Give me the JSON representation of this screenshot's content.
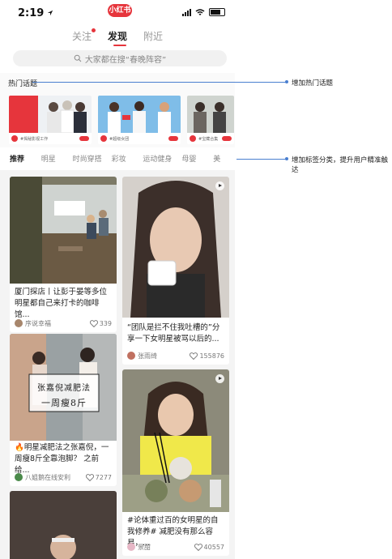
{
  "status_bar": {
    "time": "2:19",
    "brand": "小红书"
  },
  "top_nav": {
    "tabs": [
      "关注",
      "发现",
      "附近"
    ]
  },
  "search": {
    "placeholder": "大家都在搜“春晚阵容”"
  },
  "hot_topics": {
    "title": "热门话题",
    "cards": [
      {
        "caption": "#揭秘影视工作"
      },
      {
        "caption": "#超级女团"
      },
      {
        "caption": "#宝藏合集"
      }
    ]
  },
  "tags": [
    "推荐",
    "明星",
    "时尚穿搭",
    "彩妆",
    "运动健身",
    "母婴",
    "美"
  ],
  "feed": [
    {
      "title": "厦门探店丨让彭于晏等多位明星都自己来打卡的咖啡馆...",
      "author": "序说幸福",
      "likes": "339",
      "video": false
    },
    {
      "title": "🔥明星减肥法之张嘉倪，一周瘦8斤全靠泡脚？ 之前给...",
      "author": "八姐鹅在线安利",
      "likes": "7277",
      "video": false,
      "overlay": {
        "line1": "张嘉倪减肥法",
        "line2": "一周瘦8斤"
      }
    },
    {
      "title": "“团队是拦不住我吐槽的”分享一下女明星被骂以后的...",
      "author": "张雨绮",
      "likes": "155876",
      "video": true
    },
    {
      "title": "#论体重过百的女明星的自我修养# 减肥没有那么容易，...",
      "author": "景甜",
      "likes": "40557",
      "video": true
    }
  ],
  "annotations": [
    {
      "text": "增加热门话题"
    },
    {
      "text": "增加标签分类，提升用户精准触达"
    }
  ],
  "colors": {
    "accent": "#e6353c",
    "annotation_line": "#4a7fd0"
  }
}
